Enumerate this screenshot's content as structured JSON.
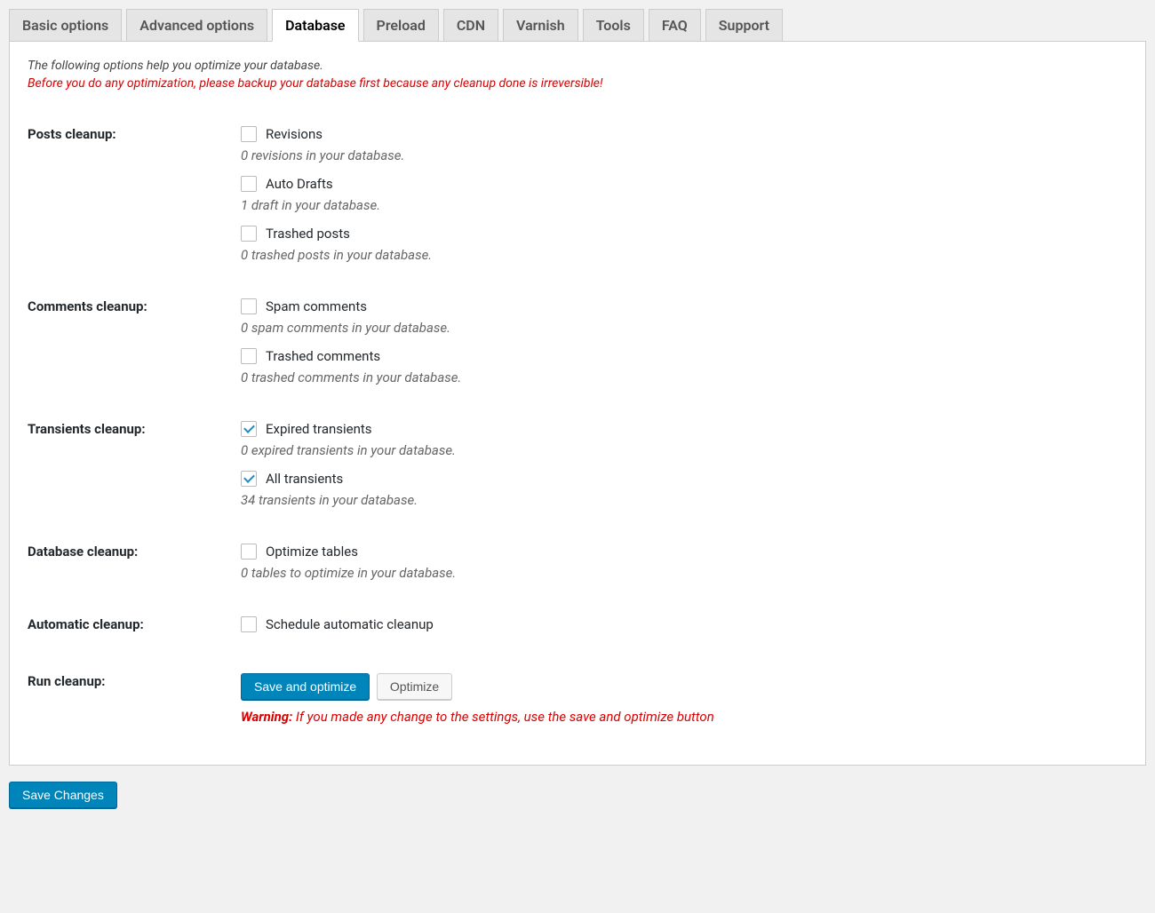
{
  "tabs": [
    {
      "label": "Basic options",
      "active": false
    },
    {
      "label": "Advanced options",
      "active": false
    },
    {
      "label": "Database",
      "active": true
    },
    {
      "label": "Preload",
      "active": false
    },
    {
      "label": "CDN",
      "active": false
    },
    {
      "label": "Varnish",
      "active": false
    },
    {
      "label": "Tools",
      "active": false
    },
    {
      "label": "FAQ",
      "active": false
    },
    {
      "label": "Support",
      "active": false
    }
  ],
  "intro": "The following options help you optimize your database.",
  "intro_warning": "Before you do any optimization, please backup your database first because any cleanup done is irreversible!",
  "sections": {
    "posts": {
      "title": "Posts cleanup:",
      "items": [
        {
          "label": "Revisions",
          "checked": false,
          "desc": "0 revisions in your database."
        },
        {
          "label": "Auto Drafts",
          "checked": false,
          "desc": "1 draft in your database."
        },
        {
          "label": "Trashed posts",
          "checked": false,
          "desc": "0 trashed posts in your database."
        }
      ]
    },
    "comments": {
      "title": "Comments cleanup:",
      "items": [
        {
          "label": "Spam comments",
          "checked": false,
          "desc": "0 spam comments in your database."
        },
        {
          "label": "Trashed comments",
          "checked": false,
          "desc": "0 trashed comments in your database."
        }
      ]
    },
    "transients": {
      "title": "Transients cleanup:",
      "items": [
        {
          "label": "Expired transients",
          "checked": true,
          "desc": "0 expired transients in your database."
        },
        {
          "label": "All transients",
          "checked": true,
          "desc": "34 transients in your database."
        }
      ]
    },
    "database": {
      "title": "Database cleanup:",
      "items": [
        {
          "label": "Optimize tables",
          "checked": false,
          "desc": "0 tables to optimize in your database."
        }
      ]
    },
    "automatic": {
      "title": "Automatic cleanup:",
      "items": [
        {
          "label": "Schedule automatic cleanup",
          "checked": false,
          "desc": ""
        }
      ]
    },
    "run": {
      "title": "Run cleanup:",
      "primary_btn": "Save and optimize",
      "secondary_btn": "Optimize",
      "warning_label": "Warning:",
      "warning_text": " If you made any change to the settings, use the save and optimize button"
    }
  },
  "footer": {
    "save_btn": "Save Changes"
  }
}
